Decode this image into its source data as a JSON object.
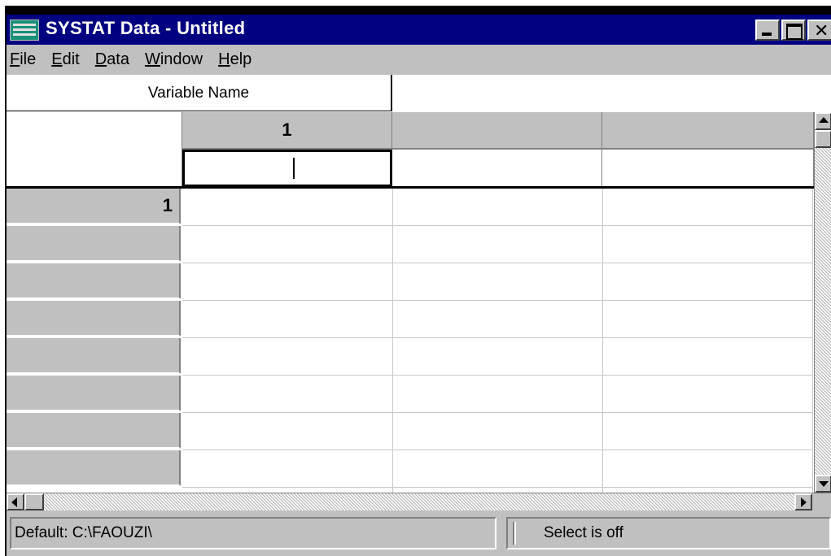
{
  "window": {
    "title": "SYSTAT Data - Untitled",
    "title_bar_color": "#000080",
    "close_glyph": "✕"
  },
  "menu": [
    {
      "label": "File",
      "mnemonic_index": 0
    },
    {
      "label": "Edit",
      "mnemonic_index": 0
    },
    {
      "label": "Data",
      "mnemonic_index": 0
    },
    {
      "label": "Window",
      "mnemonic_index": 0
    },
    {
      "label": "Help",
      "mnemonic_index": 0
    }
  ],
  "grid": {
    "variable_name_label": "Variable Name",
    "columns": [
      "1",
      "",
      ""
    ],
    "variable_names": [
      "",
      "",
      ""
    ],
    "rows": [
      "1",
      "",
      "",
      "",
      "",
      "",
      "",
      ""
    ]
  },
  "status": {
    "path": "Default: C:\\FAOUZI\\",
    "select_state": "Select is off"
  }
}
